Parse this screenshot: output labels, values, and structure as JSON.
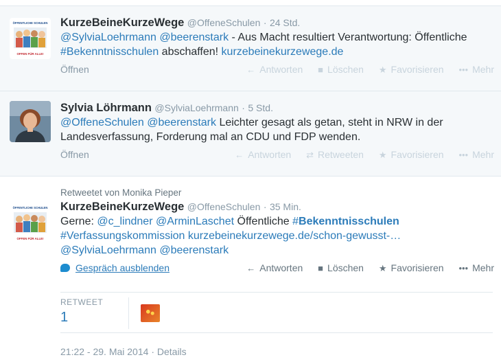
{
  "tweets": [
    {
      "name": "KurzeBeineKurzeWege",
      "handle": "@OffeneSchulen",
      "dot": "·",
      "time": "24 Std.",
      "parts": [
        {
          "t": "@SylviaLoehrmann",
          "c": "link"
        },
        {
          "t": " ",
          "c": ""
        },
        {
          "t": "@beerenstark",
          "c": "link"
        },
        {
          "t": " - Aus Macht resultiert Verantwortung: Öffentliche ",
          "c": ""
        },
        {
          "t": "#Bekenntnisschulen",
          "c": "link"
        },
        {
          "t": " abschaffen! ",
          "c": ""
        },
        {
          "t": "kurzebeinekurzewege.de",
          "c": "link"
        }
      ],
      "open_label": "Öffnen",
      "avatar": {
        "top_text": "ÖFFENTLICHE SCHULEN",
        "bottom_text": "OFFEN FÜR ALLE!",
        "icon": "children-group-logo"
      }
    },
    {
      "name": "Sylvia Löhrmann",
      "handle": "@SylviaLoehrmann",
      "dot": "·",
      "time": "5 Std.",
      "parts": [
        {
          "t": "@OffeneSchulen",
          "c": "link"
        },
        {
          "t": " ",
          "c": ""
        },
        {
          "t": "@beerenstark",
          "c": "link"
        },
        {
          "t": " Leichter gesagt als getan, steht in NRW in der Landesverfassung, Forderung mal an CDU und FDP wenden.",
          "c": ""
        }
      ],
      "open_label": "Öffnen",
      "avatar": {
        "icon": "person-portrait"
      }
    },
    {
      "context": "Retweetet von Monika Pieper",
      "name": "KurzeBeineKurzeWege",
      "handle": "@OffeneSchulen",
      "dot": "·",
      "time": "35 Min.",
      "parts": [
        {
          "t": "Gerne: ",
          "c": ""
        },
        {
          "t": "@c_lindner",
          "c": "link"
        },
        {
          "t": " ",
          "c": ""
        },
        {
          "t": "@ArminLaschet",
          "c": "link"
        },
        {
          "t": " Öffentliche ",
          "c": ""
        },
        {
          "t": "#",
          "c": "link"
        },
        {
          "t": "Bekenntnisschulen",
          "c": "hashtag-bold"
        },
        {
          "t": " ",
          "c": ""
        },
        {
          "t": "#Verfassungskommission",
          "c": "link"
        },
        {
          "t": " ",
          "c": ""
        },
        {
          "t": "kurzebeinekurzewege.de/schon-gewusst-…",
          "c": "link"
        },
        {
          "t": " ",
          "c": ""
        },
        {
          "t": "@SylviaLoehrmann",
          "c": "link"
        },
        {
          "t": " ",
          "c": ""
        },
        {
          "t": "@beerenstark",
          "c": "link"
        }
      ],
      "conversation_label": "Gespräch ausblenden",
      "retweet_label": "RETWEET",
      "retweet_count": "1",
      "timestamp": "21:22 - 29. Mai 2014",
      "details_label": "Details",
      "meta_dot": "·",
      "avatar": {
        "top_text": "ÖFFENTLICHE SCHULEN",
        "bottom_text": "OFFEN FÜR ALLE!",
        "icon": "children-group-logo"
      }
    }
  ],
  "actions": {
    "reply": "Antworten",
    "delete": "Löschen",
    "retweet": "Retweeten",
    "favorite": "Favorisieren",
    "more": "Mehr"
  },
  "icons": {
    "reply": "reply-arrow-icon",
    "delete": "trash-icon",
    "retweet": "retweet-icon",
    "favorite": "star-icon",
    "more": "more-dots-icon",
    "conversation": "speech-bubble-icon"
  },
  "colors": {
    "link": "#2b7bb9",
    "muted": "#8899a6",
    "faint": "#c8d4dd",
    "highlight_bg": "#f5f8fa"
  }
}
